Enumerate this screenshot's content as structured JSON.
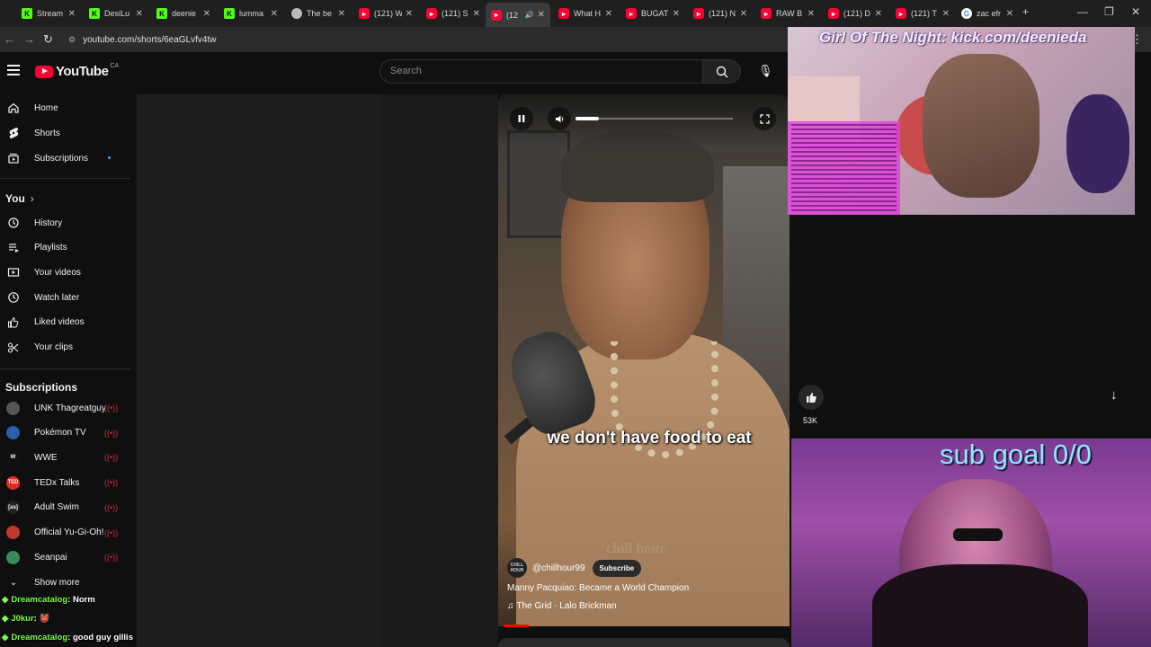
{
  "tabs": [
    {
      "label": "Stream",
      "fav": "k",
      "x": 0
    },
    {
      "label": "DesiLu",
      "fav": "k",
      "x": 0
    },
    {
      "label": "deenie",
      "fav": "k",
      "x": 0
    },
    {
      "label": "lumma",
      "fav": "k",
      "x": 0
    },
    {
      "label": "The be",
      "fav": "gr",
      "x": 0
    },
    {
      "label": "(121) W",
      "fav": "yt",
      "x": 0
    },
    {
      "label": "(121) S",
      "fav": "yt",
      "x": 0
    },
    {
      "label": "(12",
      "fav": "yt",
      "x": 0
    },
    {
      "label": "What H",
      "fav": "yt",
      "x": 0
    },
    {
      "label": "BUGAT",
      "fav": "yt",
      "x": 0
    },
    {
      "label": "(121) N",
      "fav": "yt",
      "x": 0
    },
    {
      "label": "RAW B",
      "fav": "yt",
      "x": 0
    },
    {
      "label": "(121) D",
      "fav": "yt",
      "x": 0
    },
    {
      "label": "(121) T",
      "fav": "yt",
      "x": 0
    },
    {
      "label": "zac efr",
      "fav": "g",
      "x": 0
    }
  ],
  "address": {
    "url": "youtube.com/shorts/6eaGLvfv4tw"
  },
  "masthead": {
    "logo": "YouTube",
    "region": "CA",
    "search_placeholder": "Search"
  },
  "sidebar": {
    "main": [
      {
        "label": "Home",
        "icon": "home-icon"
      },
      {
        "label": "Shorts",
        "icon": "shorts-icon"
      },
      {
        "label": "Subscriptions",
        "icon": "subscriptions-icon"
      }
    ],
    "you_heading": "You",
    "you": [
      {
        "label": "History",
        "icon": "history-icon"
      },
      {
        "label": "Playlists",
        "icon": "playlists-icon"
      },
      {
        "label": "Your videos",
        "icon": "your-videos-icon"
      },
      {
        "label": "Watch later",
        "icon": "watch-later-icon"
      },
      {
        "label": "Liked videos",
        "icon": "liked-videos-icon"
      },
      {
        "label": "Your clips",
        "icon": "clips-icon"
      }
    ],
    "subs_heading": "Subscriptions",
    "subscriptions": [
      {
        "label": "UNK Thagreatguy",
        "color": "#555555",
        "abbr": ""
      },
      {
        "label": "Pokémon TV",
        "color": "#2a5fb0",
        "abbr": ""
      },
      {
        "label": "WWE",
        "color": "#111111",
        "abbr": "W"
      },
      {
        "label": "TEDx Talks",
        "color": "#e62b1e",
        "abbr": "TED"
      },
      {
        "label": "Adult Swim",
        "color": "#222222",
        "abbr": "[as]"
      },
      {
        "label": "Official Yu-Gi-Oh!",
        "color": "#c0392b",
        "abbr": ""
      },
      {
        "label": "Seanpai",
        "color": "#3a8a5a",
        "abbr": ""
      }
    ],
    "show_more": "Show more"
  },
  "short": {
    "caption": "we don't have food to eat",
    "watermark": "chill hour",
    "channel": "@chillhour99",
    "channel_avatar": "CHILL HOUR",
    "subscribe": "Subscribe",
    "title": "Manny Pacquiao: Became a World Champion",
    "music": "The Grid · Lalo Brickman",
    "volume_level": 0.15
  },
  "actions": {
    "likes": "53K"
  },
  "overlays": {
    "top_title": "Girl Of The Night: kick.com/deenieda",
    "sub_goal": "sub goal 0/0"
  },
  "chat": [
    {
      "name": "Dreamcatalog",
      "text": ": Norm"
    },
    {
      "name": "J0kur",
      "text": ": 👹"
    },
    {
      "name": "Dreamcatalog",
      "text": ": good guy gillis"
    }
  ]
}
